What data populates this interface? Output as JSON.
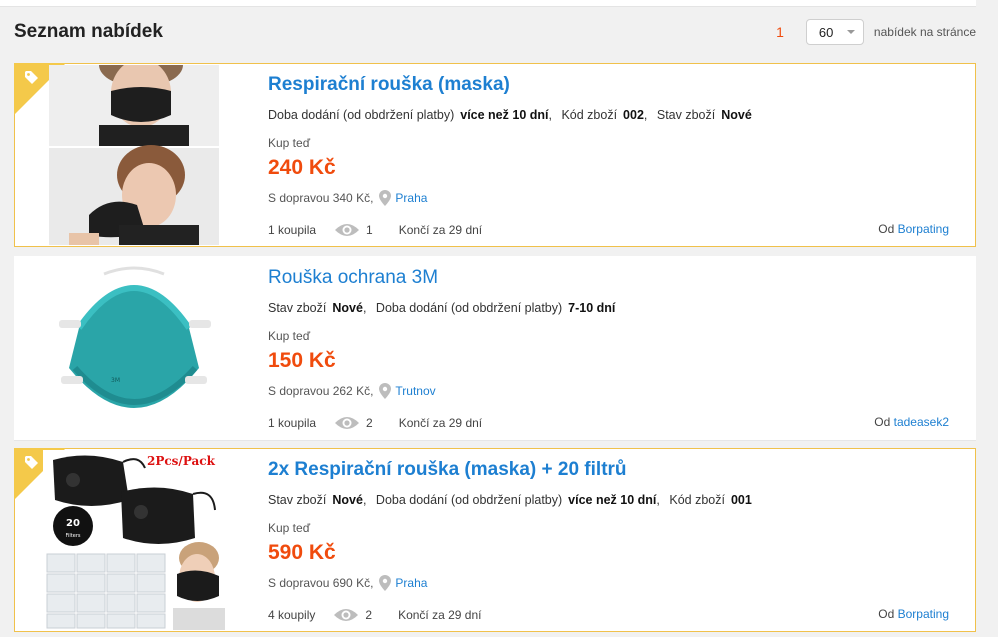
{
  "header": {
    "title": "Seznam nabídek",
    "page_number": "1",
    "per_page_value": "60",
    "per_page_label": "nabídek na stránce"
  },
  "offers": [
    {
      "title": "Respirační rouška (maska)",
      "attrs": [
        {
          "label": "Doba dodání (od obdržení platby)",
          "value": "více než 10 dní"
        },
        {
          "label": "Kód zboží",
          "value": "002"
        },
        {
          "label": "Stav zboží",
          "value": "Nové"
        }
      ],
      "buy_label": "Kup teď",
      "price": "240 Kč",
      "shipping": "S dopravou 340 Kč,",
      "location": "Praha",
      "sold": "1 koupila",
      "views": "1",
      "ends": "Končí za 29 dní",
      "seller_prefix": "Od",
      "seller": "Borpating",
      "featured": true
    },
    {
      "title": "Rouška ochrana 3M",
      "attrs": [
        {
          "label": "Stav zboží",
          "value": "Nové"
        },
        {
          "label": "Doba dodání (od obdržení platby)",
          "value": "7-10 dní"
        }
      ],
      "buy_label": "Kup teď",
      "price": "150 Kč",
      "shipping": "S dopravou 262 Kč,",
      "location": "Trutnov",
      "sold": "1 koupila",
      "views": "2",
      "ends": "Končí za 29 dní",
      "seller_prefix": "Od",
      "seller": "tadeasek2",
      "featured": false
    },
    {
      "title": "2x Respirační rouška (maska) + 20 filtrů",
      "attrs": [
        {
          "label": "Stav zboží",
          "value": "Nové"
        },
        {
          "label": "Doba dodání (od obdržení platby)",
          "value": "více než 10 dní"
        },
        {
          "label": "Kód zboží",
          "value": "001"
        }
      ],
      "buy_label": "Kup teď",
      "price": "590 Kč",
      "shipping": "S dopravou 690 Kč,",
      "location": "Praha",
      "sold": "4 koupily",
      "views": "2",
      "ends": "Končí za 29 dní",
      "seller_prefix": "Od",
      "seller": "Borpating",
      "featured": true,
      "image_text": {
        "pack": "2Pcs/Pack",
        "count": "20",
        "filters": "Filters"
      }
    }
  ],
  "colors": {
    "price": "#f04b0d",
    "link": "#1d7fd1",
    "featured_border": "#f0c14b",
    "tag": "#f4c94a"
  }
}
